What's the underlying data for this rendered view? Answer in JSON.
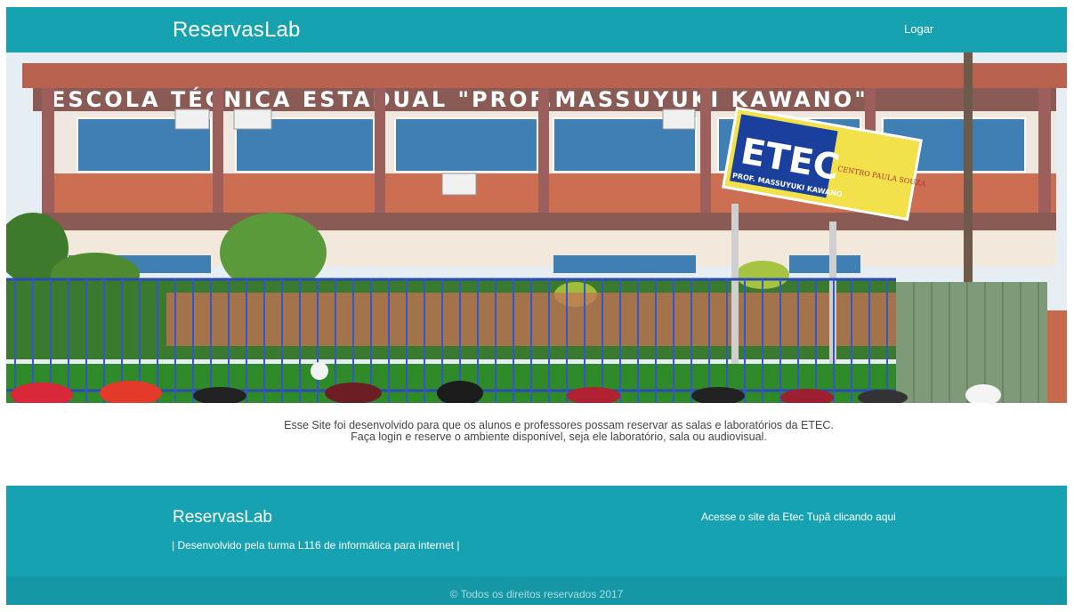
{
  "header": {
    "brand": "ReservasLab",
    "login_label": "Logar"
  },
  "hero": {
    "school_name_sign": "ESCOLA TÉCNICA ESTADUAL \"PROF.MASSUYUKI KAWANO\"",
    "etec_sign": {
      "title": "ETEC",
      "subtitle": "PROF. MASSUYUKI KAWANO",
      "badge": "CENTRO PAULA SOUZA"
    }
  },
  "intro": {
    "line1": "Esse Site foi desenvolvido para que os alunos e professores possam reservar as salas e laboratórios da ETEC.",
    "line2": "Faça login e reserve o ambiente disponível, seja ele laboratório, sala ou audiovisual."
  },
  "footer": {
    "brand": "ReservasLab",
    "credit": "| Desenvolvido pela turma L116 de informática para internet |",
    "link_label": "Acesse o site da Etec Tupã clicando aqui",
    "copyright": "© Todos os direitos reservados 2017"
  },
  "colors": {
    "primary": "#17a2b2",
    "copyright_bar": "#1597a6"
  }
}
